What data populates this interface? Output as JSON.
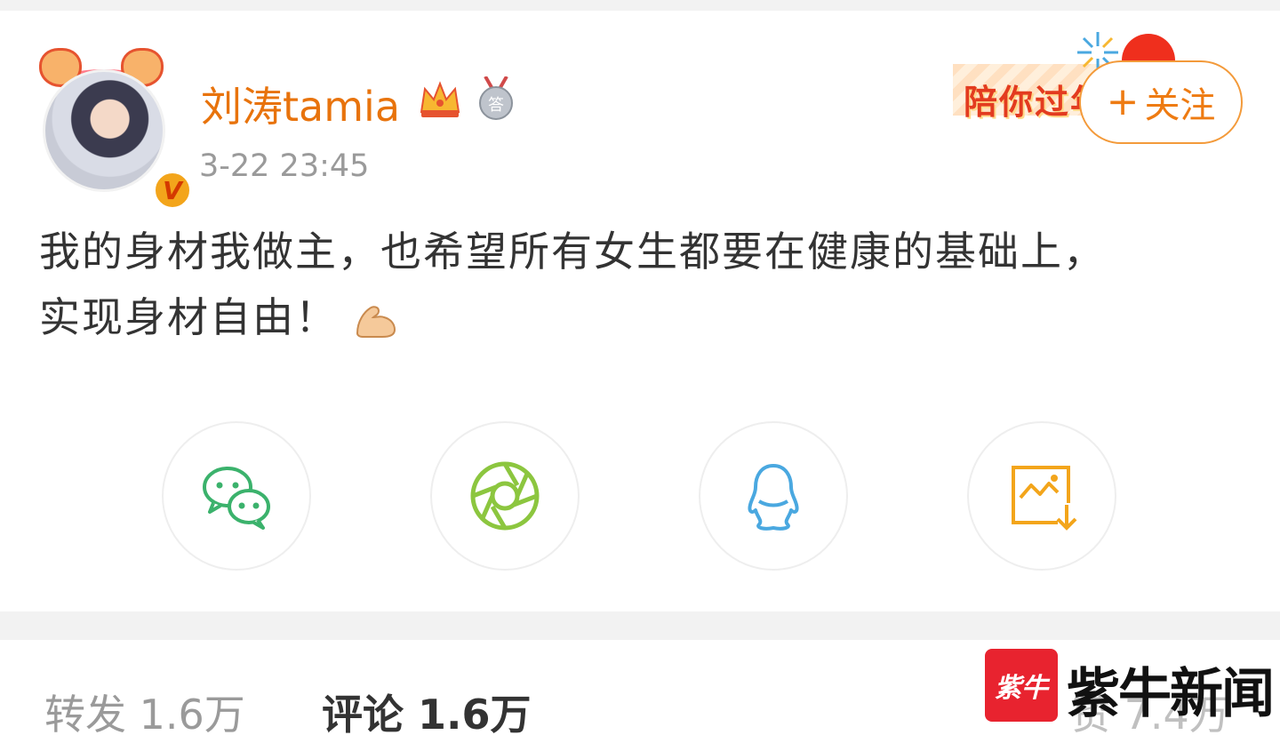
{
  "user": {
    "name": "刘涛tamia",
    "timestamp": "3-22 23:45"
  },
  "follow_button": {
    "plus": "+",
    "label": "关注"
  },
  "banner": {
    "text": "陪你过年"
  },
  "post": {
    "lines": [
      "我的身材我做主，也希望所有女生都要在健康的基础上，",
      "实现身材自由！"
    ],
    "emoji": "flexed-biceps"
  },
  "share": {
    "items": [
      {
        "icon": "wechat-icon",
        "color": "#3bb26c"
      },
      {
        "icon": "moments-icon",
        "color": "#8cc63f"
      },
      {
        "icon": "qq-icon",
        "color": "#4aa8e0"
      },
      {
        "icon": "save-image-icon",
        "color": "#f3a51b"
      }
    ]
  },
  "actions": {
    "repost": "转发 1.6万",
    "comment": "评论 1.6万",
    "like": "赞 7.4万"
  },
  "watermark": {
    "logo_text": "紫牛",
    "brand": "紫牛新闻"
  },
  "colors": {
    "username": "#e8730c",
    "follow": "#ee7b12",
    "accent": "#f3a51b"
  }
}
